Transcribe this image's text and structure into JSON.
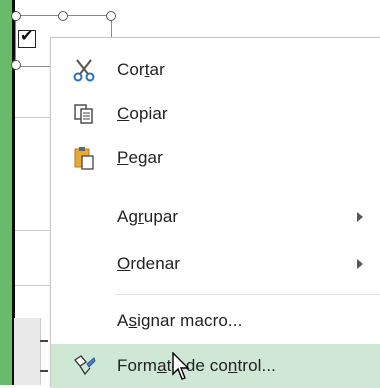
{
  "control": {
    "checked_glyph": "✔"
  },
  "menu": {
    "items": [
      {
        "pre": "Cor",
        "ul": "t",
        "post": "ar",
        "icon": "scissors-icon",
        "submenu": false
      },
      {
        "pre": "",
        "ul": "C",
        "post": "opiar",
        "icon": "copy-icon",
        "submenu": false
      },
      {
        "pre": "",
        "ul": "P",
        "post": "egar",
        "icon": "paste-icon",
        "submenu": false
      },
      {
        "pre": "Ag",
        "ul": "r",
        "post": "upar",
        "icon": "",
        "submenu": true
      },
      {
        "pre": "",
        "ul": "O",
        "post": "rdenar",
        "icon": "",
        "submenu": true
      },
      {
        "pre": "A",
        "ul": "s",
        "post": "ignar macro...",
        "icon": "",
        "submenu": false
      },
      {
        "pre": "Form",
        "ul": "a",
        "post": "to de co",
        "ul2": "n",
        "post2": "trol...",
        "icon": "format-control-icon",
        "submenu": false
      }
    ]
  },
  "colors": {
    "hover_bg": "#cfe8d6",
    "sheet_green": "#4caf50"
  }
}
